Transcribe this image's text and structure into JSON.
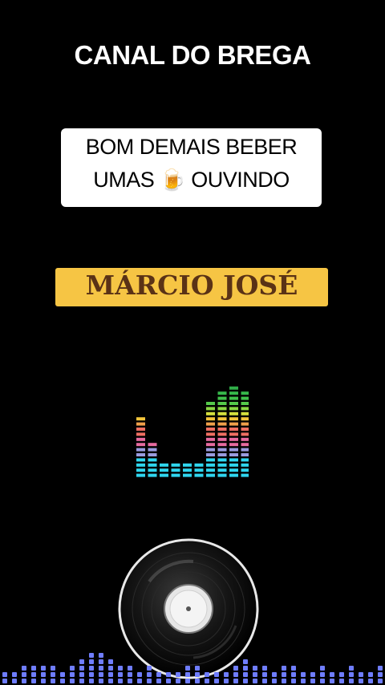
{
  "channel_title": "CANAL DO BREGA",
  "caption": {
    "line1": "BOM DEMAIS BEBER",
    "line2_before": "UMAS",
    "line2_icon": "beer-mug-icon",
    "line2_after": "OUVINDO"
  },
  "artist": "MÁRCIO JOSÉ",
  "colors": {
    "background": "#000000",
    "caption_bg": "#ffffff",
    "artist_bg": "#f6c544",
    "artist_text": "#5a3216",
    "wave": "#6f7dff"
  },
  "equalizer_levels": [
    12,
    7,
    3,
    3,
    3,
    3,
    15,
    17,
    18,
    17,
    16
  ],
  "wave_levels": [
    2,
    2,
    3,
    3,
    3,
    3,
    2,
    3,
    4,
    5,
    5,
    4,
    3,
    3,
    2,
    3,
    2,
    2,
    2,
    3,
    3,
    2,
    2,
    2,
    3,
    4,
    3,
    3,
    2,
    3,
    3,
    2,
    2,
    3,
    2,
    2,
    3,
    2,
    2,
    3
  ]
}
